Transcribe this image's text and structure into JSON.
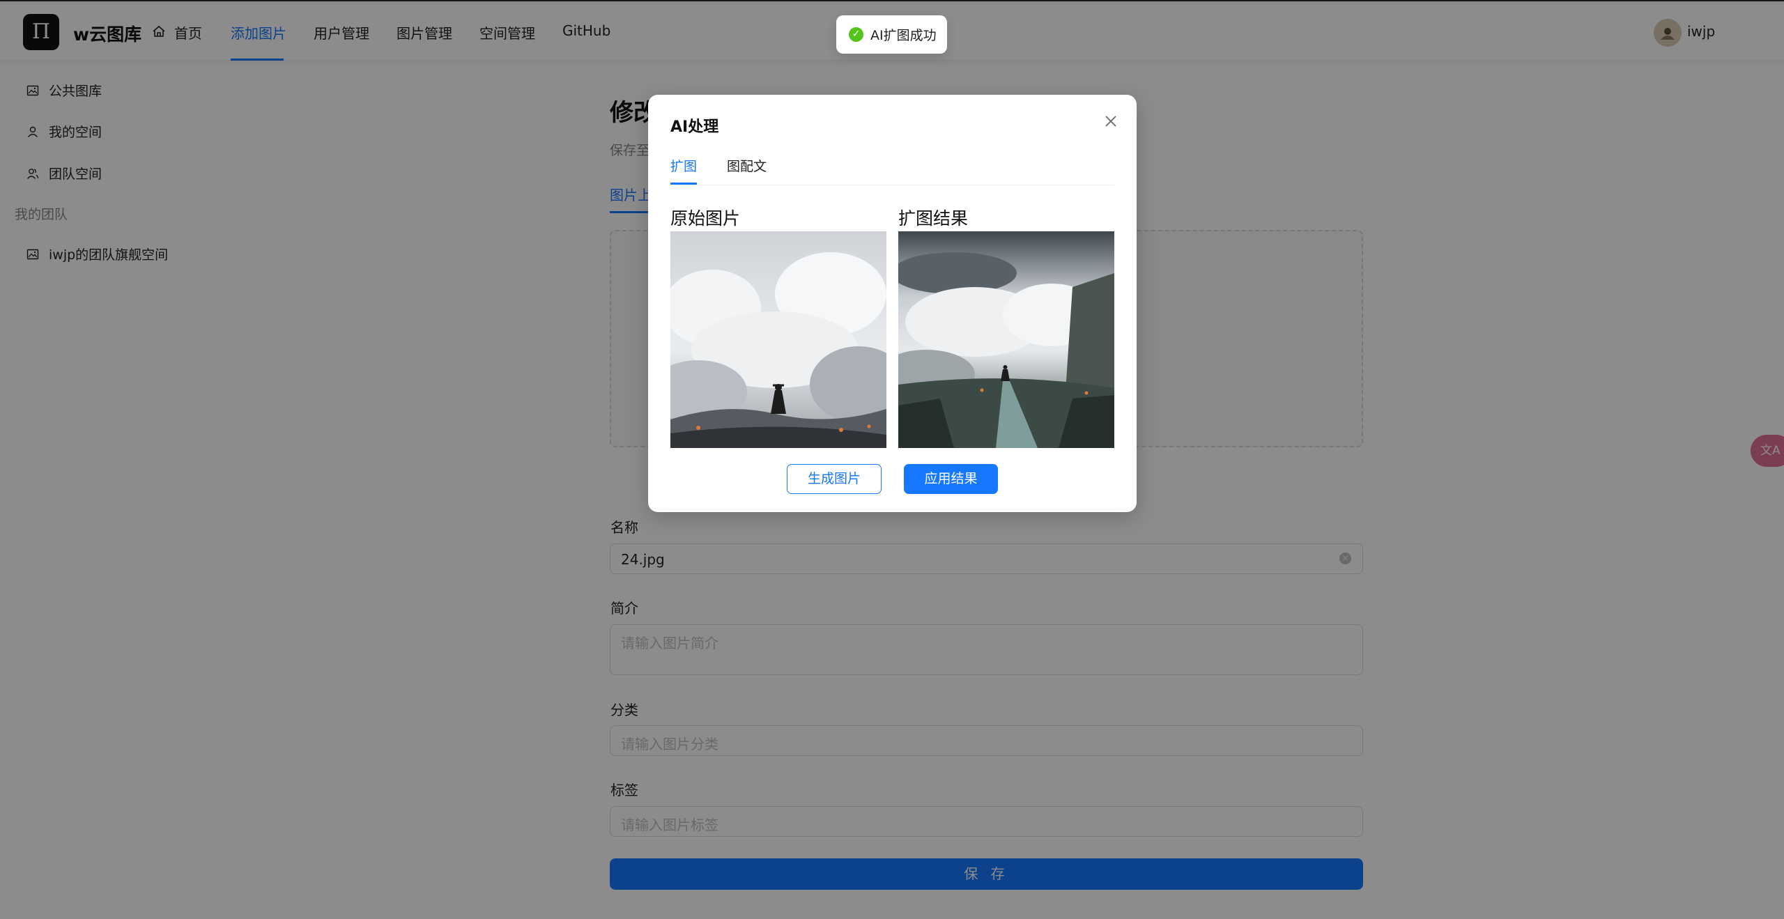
{
  "header": {
    "logo_glyph": "Π",
    "brand": "w云图库",
    "nav": [
      "首页",
      "添加图片",
      "用户管理",
      "图片管理",
      "空间管理",
      "GitHub"
    ],
    "active_nav": "添加图片",
    "username": "iwjp"
  },
  "sidebar": {
    "items": [
      {
        "label": "公共图库",
        "icon": "picture-icon"
      },
      {
        "label": "我的空间",
        "icon": "user-icon"
      },
      {
        "label": "团队空间",
        "icon": "team-icon"
      }
    ],
    "group_title": "我的团队",
    "team_items": [
      {
        "label": "iwjp的团队旗舰空间",
        "icon": "picture-icon"
      }
    ]
  },
  "main": {
    "title": "修改图片",
    "subtitle": "保存至",
    "tab": "图片上传",
    "fields": {
      "name": {
        "label": "名称",
        "value": "24.jpg"
      },
      "intro": {
        "label": "简介",
        "placeholder": "请输入图片简介"
      },
      "category": {
        "label": "分类",
        "placeholder": "请输入图片分类"
      },
      "tags": {
        "label": "标签",
        "placeholder": "请输入图片标签"
      }
    },
    "save_label": "保 存"
  },
  "modal": {
    "title": "AI处理",
    "tabs": [
      "扩图",
      "图配文"
    ],
    "active_tab": "扩图",
    "original_title": "原始图片",
    "result_title": "扩图结果",
    "generate_label": "生成图片",
    "apply_label": "应用结果"
  },
  "toast": {
    "text": "AI扩图成功",
    "status_color": "#52c41a"
  },
  "colors": {
    "accent": "#1677ff"
  },
  "float_button": {
    "label": "文A",
    "icon": "translate-icon"
  }
}
